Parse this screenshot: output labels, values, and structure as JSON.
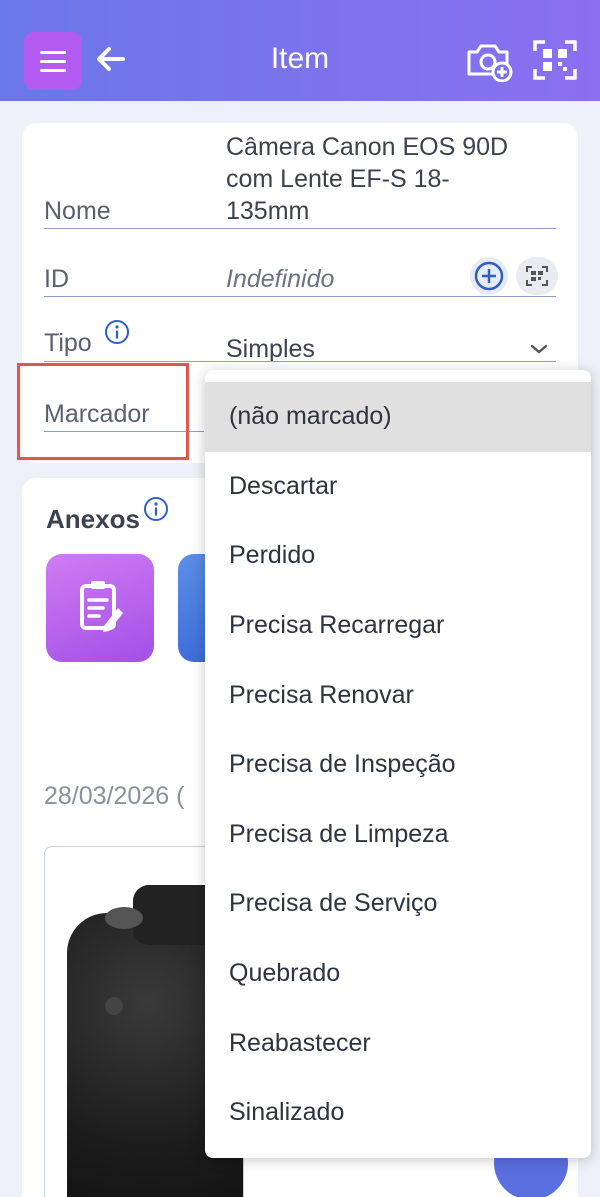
{
  "header": {
    "title": "Item",
    "colors": {
      "gradient_start": "#6b78e8",
      "gradient_end": "#8a6ff0",
      "menu_bg": "#b35cf2"
    },
    "icons": [
      "menu-icon",
      "back-arrow-icon",
      "camera-add-icon",
      "qr-scan-icon"
    ]
  },
  "form": {
    "nome": {
      "label": "Nome",
      "value": "Câmera Canon EOS 90D com Lente EF-S 18-135mm"
    },
    "id": {
      "label": "ID",
      "value": "Indefinido"
    },
    "tipo": {
      "label": "Tipo",
      "value": "Simples"
    },
    "marcador": {
      "label": "Marcador"
    }
  },
  "anexos": {
    "title": "Anexos",
    "date": "28/03/2026 (",
    "tiles": [
      "notes-icon",
      "attachment-icon"
    ]
  },
  "dropdown": {
    "selected": "(não marcado)",
    "options": [
      "(não marcado)",
      "Descartar",
      "Perdido",
      "Precisa Recarregar",
      "Precisa Renovar",
      "Precisa de Inspeção",
      "Precisa de Limpeza",
      "Precisa de Serviço",
      "Quebrado",
      "Reabastecer",
      "Sinalizado"
    ]
  },
  "highlight_color": "#e0584c"
}
